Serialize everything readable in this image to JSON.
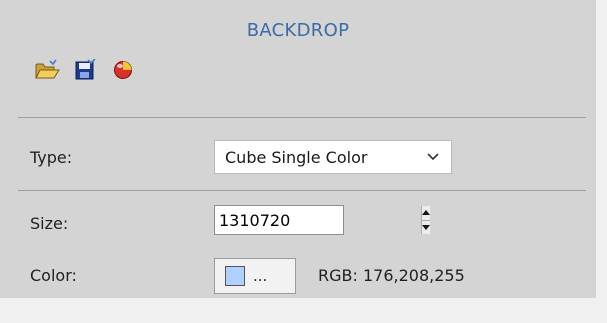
{
  "header": {
    "title": "BACKDROP"
  },
  "toolbar": {
    "open_icon": "folder-open-icon",
    "save_icon": "save-icon",
    "color_icon": "color-sphere-icon"
  },
  "fields": {
    "type_label": "Type:",
    "type_value": "Cube Single Color",
    "size_label": "Size:",
    "size_value": "1310720",
    "color_label": "Color:",
    "color_button_text": "...",
    "rgb_text": "RGB: 176,208,255"
  },
  "colors": {
    "accent": "#3b6ba8",
    "swatch": "#b0d0ff",
    "panel_bg": "#d4d4d4"
  }
}
